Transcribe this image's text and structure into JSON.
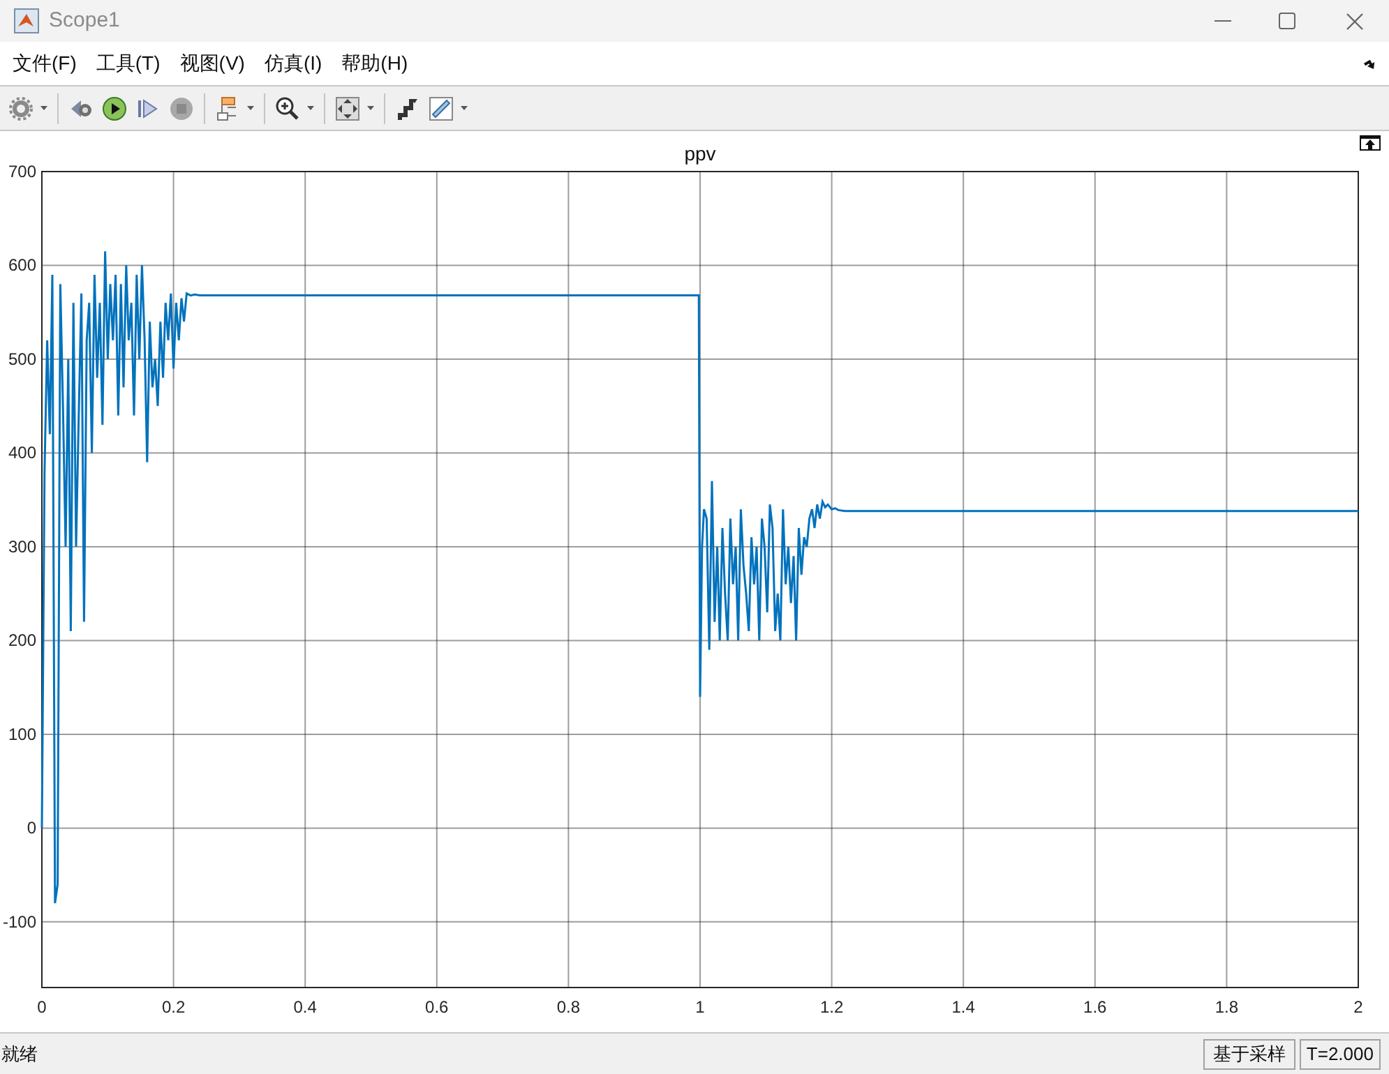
{
  "window": {
    "title": "Scope1"
  },
  "menu": [
    {
      "label": "文件(F)"
    },
    {
      "label": "工具(T)"
    },
    {
      "label": "视图(V)"
    },
    {
      "label": "仿真(I)"
    },
    {
      "label": "帮助(H)"
    }
  ],
  "toolbar": [
    {
      "kind": "settings",
      "dropdown": true
    },
    {
      "kind": "step-back",
      "dropdown": false
    },
    {
      "kind": "run",
      "dropdown": false
    },
    {
      "kind": "step-forward",
      "dropdown": false
    },
    {
      "kind": "stop",
      "dropdown": false
    },
    {
      "kind": "signals",
      "dropdown": true
    },
    {
      "kind": "zoom",
      "dropdown": true
    },
    {
      "kind": "fit",
      "dropdown": true
    },
    {
      "kind": "triggers",
      "dropdown": false
    },
    {
      "kind": "measure",
      "dropdown": true
    }
  ],
  "plot": {
    "chart_data": {
      "type": "line",
      "title": "ppv",
      "xlim": [
        0,
        2
      ],
      "ylim": [
        -170,
        700
      ],
      "xticks": [
        0,
        0.2,
        0.4,
        0.6,
        0.8,
        1,
        1.2,
        1.4,
        1.6,
        1.8,
        2
      ],
      "yticks": [
        -100,
        0,
        100,
        200,
        300,
        400,
        500,
        600,
        700
      ],
      "x": [
        0,
        0.004,
        0.008,
        0.012,
        0.016,
        0.02,
        0.024,
        0.028,
        0.032,
        0.036,
        0.04,
        0.044,
        0.048,
        0.052,
        0.056,
        0.06,
        0.064,
        0.068,
        0.072,
        0.076,
        0.08,
        0.084,
        0.088,
        0.092,
        0.096,
        0.1,
        0.104,
        0.108,
        0.112,
        0.116,
        0.12,
        0.124,
        0.128,
        0.132,
        0.136,
        0.14,
        0.144,
        0.148,
        0.152,
        0.156,
        0.16,
        0.164,
        0.168,
        0.172,
        0.176,
        0.18,
        0.184,
        0.188,
        0.192,
        0.196,
        0.2,
        0.204,
        0.208,
        0.212,
        0.216,
        0.22,
        0.226,
        0.232,
        0.24,
        0.25,
        0.4,
        0.6,
        0.8,
        0.998,
        1.0,
        1.003,
        1.006,
        1.01,
        1.014,
        1.018,
        1.022,
        1.026,
        1.03,
        1.034,
        1.038,
        1.042,
        1.046,
        1.05,
        1.054,
        1.058,
        1.062,
        1.066,
        1.07,
        1.074,
        1.078,
        1.082,
        1.086,
        1.09,
        1.094,
        1.098,
        1.102,
        1.106,
        1.11,
        1.114,
        1.118,
        1.122,
        1.126,
        1.13,
        1.134,
        1.138,
        1.142,
        1.146,
        1.15,
        1.154,
        1.158,
        1.162,
        1.166,
        1.17,
        1.174,
        1.178,
        1.182,
        1.186,
        1.19,
        1.194,
        1.2,
        1.205,
        1.21,
        1.22,
        1.25,
        1.4,
        1.6,
        1.8,
        2.0
      ],
      "grid": true,
      "series": [
        {
          "color": "#0072bd",
          "values": [
            0,
            380,
            520,
            420,
            590,
            -80,
            -60,
            580,
            450,
            300,
            500,
            210,
            560,
            300,
            440,
            570,
            220,
            520,
            560,
            400,
            590,
            480,
            560,
            430,
            615,
            500,
            580,
            520,
            590,
            440,
            580,
            470,
            600,
            520,
            560,
            440,
            590,
            500,
            600,
            520,
            390,
            540,
            470,
            500,
            450,
            540,
            480,
            560,
            520,
            570,
            490,
            560,
            520,
            565,
            540,
            570,
            568,
            569,
            568,
            568,
            568,
            568,
            568,
            568,
            140,
            300,
            340,
            330,
            190,
            370,
            220,
            300,
            200,
            320,
            250,
            200,
            330,
            260,
            300,
            200,
            340,
            280,
            250,
            210,
            310,
            260,
            300,
            200,
            330,
            300,
            230,
            345,
            320,
            210,
            250,
            200,
            340,
            260,
            300,
            240,
            290,
            200,
            320,
            270,
            310,
            300,
            330,
            340,
            320,
            345,
            330,
            348,
            342,
            345,
            340,
            341,
            339,
            338,
            338,
            338,
            338,
            338,
            338
          ]
        }
      ]
    }
  },
  "status_bar": {
    "message": "就绪",
    "mode": "基于采样",
    "time": "T=2.000"
  }
}
